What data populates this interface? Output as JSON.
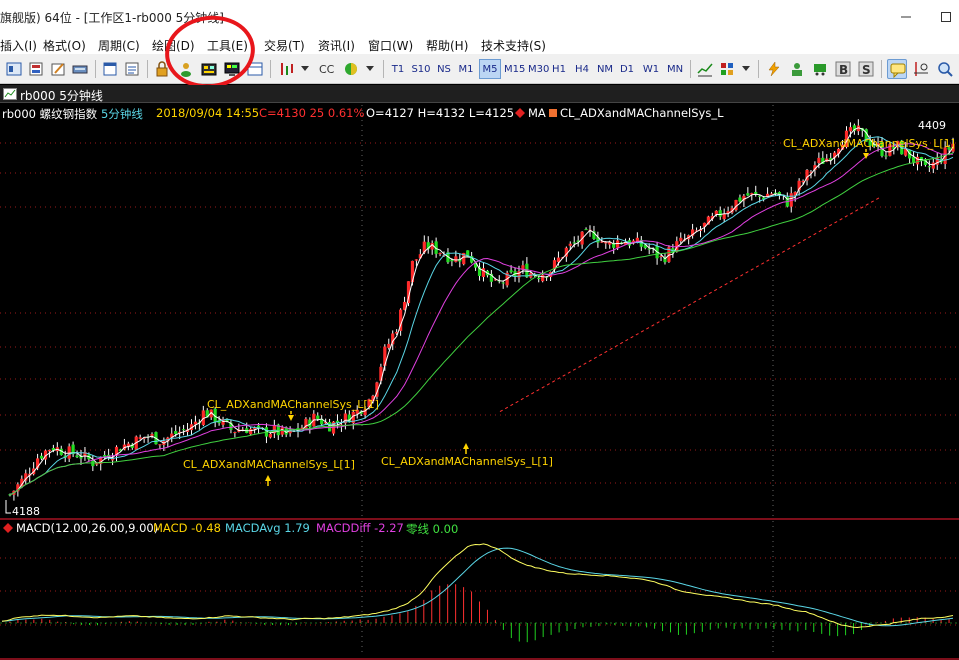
{
  "window": {
    "title": "旗舰版) 64位 - [工作区1-rb000 5分钟线]"
  },
  "menu": [
    {
      "label": "插入(I)"
    },
    {
      "label": "格式(O)"
    },
    {
      "label": "周期(C)"
    },
    {
      "label": "绘图(D)"
    },
    {
      "label": "工具(E)"
    },
    {
      "label": "交易(T)"
    },
    {
      "label": "资讯(I)"
    },
    {
      "label": "窗口(W)"
    },
    {
      "label": "帮助(H)"
    },
    {
      "label": "技术支持(S)"
    }
  ],
  "toolbar": {
    "cc_label": "CC",
    "periods": [
      "T1",
      "S10",
      "NS",
      "M1",
      "M5",
      "M15",
      "M30",
      "H1",
      "H4",
      "NM",
      "D1",
      "W1",
      "MN"
    ],
    "active_period": "M5"
  },
  "panel": {
    "title": "rb000 5分钟线"
  },
  "main_info": {
    "symbol": "rb000 螺纹钢指数",
    "period": "5分钟线",
    "datetime": "2018/09/04 14:55",
    "close": "C=4130 25 0.61%",
    "ohlc": "O=4127 H=4132 L=4125",
    "ma": "MA",
    "indicator": "CL_ADXandMAChannelSys_L"
  },
  "macd_info": {
    "name": "MACD(12.00,26.00,9.00)",
    "macd": "MACD -0.48",
    "avg": "MACDAvg 1.79",
    "diff": "MACDDiff -2.27",
    "zero": "零线 0.00"
  },
  "chart_data": {
    "type": "candlestick",
    "high_label": "4409",
    "low_label": "4188",
    "signal_label": "CL_ADXandMAChannelSys_L[1]",
    "signals": [
      {
        "index": 13,
        "position": "below"
      },
      {
        "index": 16,
        "position": "above"
      },
      {
        "index": 22,
        "position": "below"
      },
      {
        "index": 40,
        "position": "above"
      }
    ],
    "candles_shape": [
      0.02,
      0.08,
      0.16,
      0.2,
      0.18,
      0.17,
      0.14,
      0.17,
      0.2,
      0.22,
      0.24,
      0.22,
      0.25,
      0.27,
      0.33,
      0.3,
      0.26,
      0.27,
      0.25,
      0.26,
      0.24,
      0.27,
      0.31,
      0.28,
      0.3,
      0.33,
      0.38,
      0.55,
      0.66,
      0.88,
      0.95,
      0.93,
      0.9,
      0.92,
      0.85,
      0.8,
      0.83,
      0.86,
      0.84,
      0.86,
      0.93,
      0.97,
      1.0,
      0.95,
      0.97,
      0.96,
      0.94,
      0.9,
      0.95,
      0.98,
      1.02,
      1.06,
      1.1,
      1.14,
      1.13,
      1.15,
      1.11,
      1.18,
      1.25,
      1.28,
      1.35,
      1.38,
      1.34,
      1.3,
      1.32,
      1.28,
      1.23,
      1.27,
      1.33
    ],
    "macd_shape": [
      0.02,
      0.06,
      0.08,
      0.09,
      0.08,
      0.07,
      0.06,
      0.07,
      0.08,
      0.07,
      0.06,
      0.05,
      0.05,
      0.06,
      0.08,
      0.07,
      0.06,
      0.05,
      0.04,
      0.05,
      0.05,
      0.06,
      0.08,
      0.1,
      0.14,
      0.2,
      0.33,
      0.55,
      0.72,
      0.86,
      0.88,
      0.8,
      0.68,
      0.62,
      0.58,
      0.55,
      0.54,
      0.53,
      0.52,
      0.5,
      0.48,
      0.43,
      0.36,
      0.33,
      0.3,
      0.28,
      0.25,
      0.22,
      0.2,
      0.15,
      0.12,
      0.05,
      -0.02,
      -0.05,
      -0.03,
      -0.01,
      0.02,
      0.05,
      0.06,
      0.08
    ]
  }
}
